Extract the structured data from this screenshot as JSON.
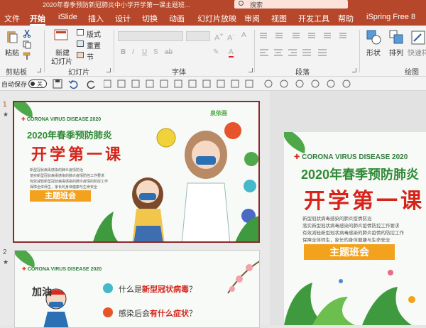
{
  "window": {
    "title": "2020年春季预防新冠肺炎中小学开学第一课主题班...",
    "search_placeholder": "搜索"
  },
  "tabs": [
    {
      "label": "文件"
    },
    {
      "label": "开始"
    },
    {
      "label": "iSlide"
    },
    {
      "label": "插入"
    },
    {
      "label": "设计"
    },
    {
      "label": "切换"
    },
    {
      "label": "动画"
    },
    {
      "label": "幻灯片放映"
    },
    {
      "label": "审阅"
    },
    {
      "label": "视图"
    },
    {
      "label": "开发工具"
    },
    {
      "label": "帮助"
    },
    {
      "label": "iSpring Free 8"
    }
  ],
  "ribbon": {
    "paste": "粘贴",
    "new_slide": "新建",
    "new_slide_2": "幻灯片",
    "layout": "版式",
    "reset": "重置",
    "section": "节",
    "shape": "形状",
    "arrange": "排列",
    "quick_style": "快速样",
    "groups": {
      "clipboard": "剪贴板",
      "slides": "幻灯片",
      "font": "字体",
      "paragraph": "段落",
      "drawing": "绘图"
    },
    "font_buttons": {
      "bold": "B",
      "italic": "I",
      "underline": "U",
      "strike": "S",
      "abc": "ab"
    }
  },
  "qat": {
    "autosave_label": "自动保存",
    "autosave_state": "关"
  },
  "slides": [
    {
      "number": "1",
      "mark": "★",
      "header": "CORONA VIRUS DISEASE 2020",
      "title": "2020年春季预防肺炎",
      "headline": "开学第一课",
      "lines": [
        "新型冠状病毒感染的肺炎疫情防治",
        "落实新型冠状病毒感染的肺炎疫情防控工作要求",
        "有效减轻新型冠状病毒感染的肺炎疫情的防控工作",
        "保障全体师生，家长的身体健康与生命安全"
      ],
      "badge": "主题班会",
      "logo": "泉依画"
    },
    {
      "number": "2",
      "mark": "★",
      "header": "CORONA VIRUS DISEASE 2020",
      "q1_pre": "什么是",
      "q1_hl": "新型冠状病毒",
      "q1_post": "？",
      "q2_pre": "感染后会",
      "q2_hl": "有什么症状",
      "q2_post": "？",
      "cheer": "加油"
    }
  ],
  "editor_slide": {
    "header": "CORONA VIRUS DISEASE 2020",
    "title": "2020年春季预防肺炎",
    "headline": "开学第一课",
    "lines": [
      "新型冠状病毒感染的肺炎疫情防治",
      "落实新型冠状病毒感染的肺炎疫情防控工作要求",
      "有效减轻新型冠状病毒感染的肺炎疫情的防控工作",
      "保障全体师生，家长的身体健康与生命安全"
    ],
    "badge": "主题班会"
  },
  "colors": {
    "accent": "#b7472a",
    "green": "#2f8a35",
    "red": "#d6241b",
    "orange": "#f2a21d"
  }
}
